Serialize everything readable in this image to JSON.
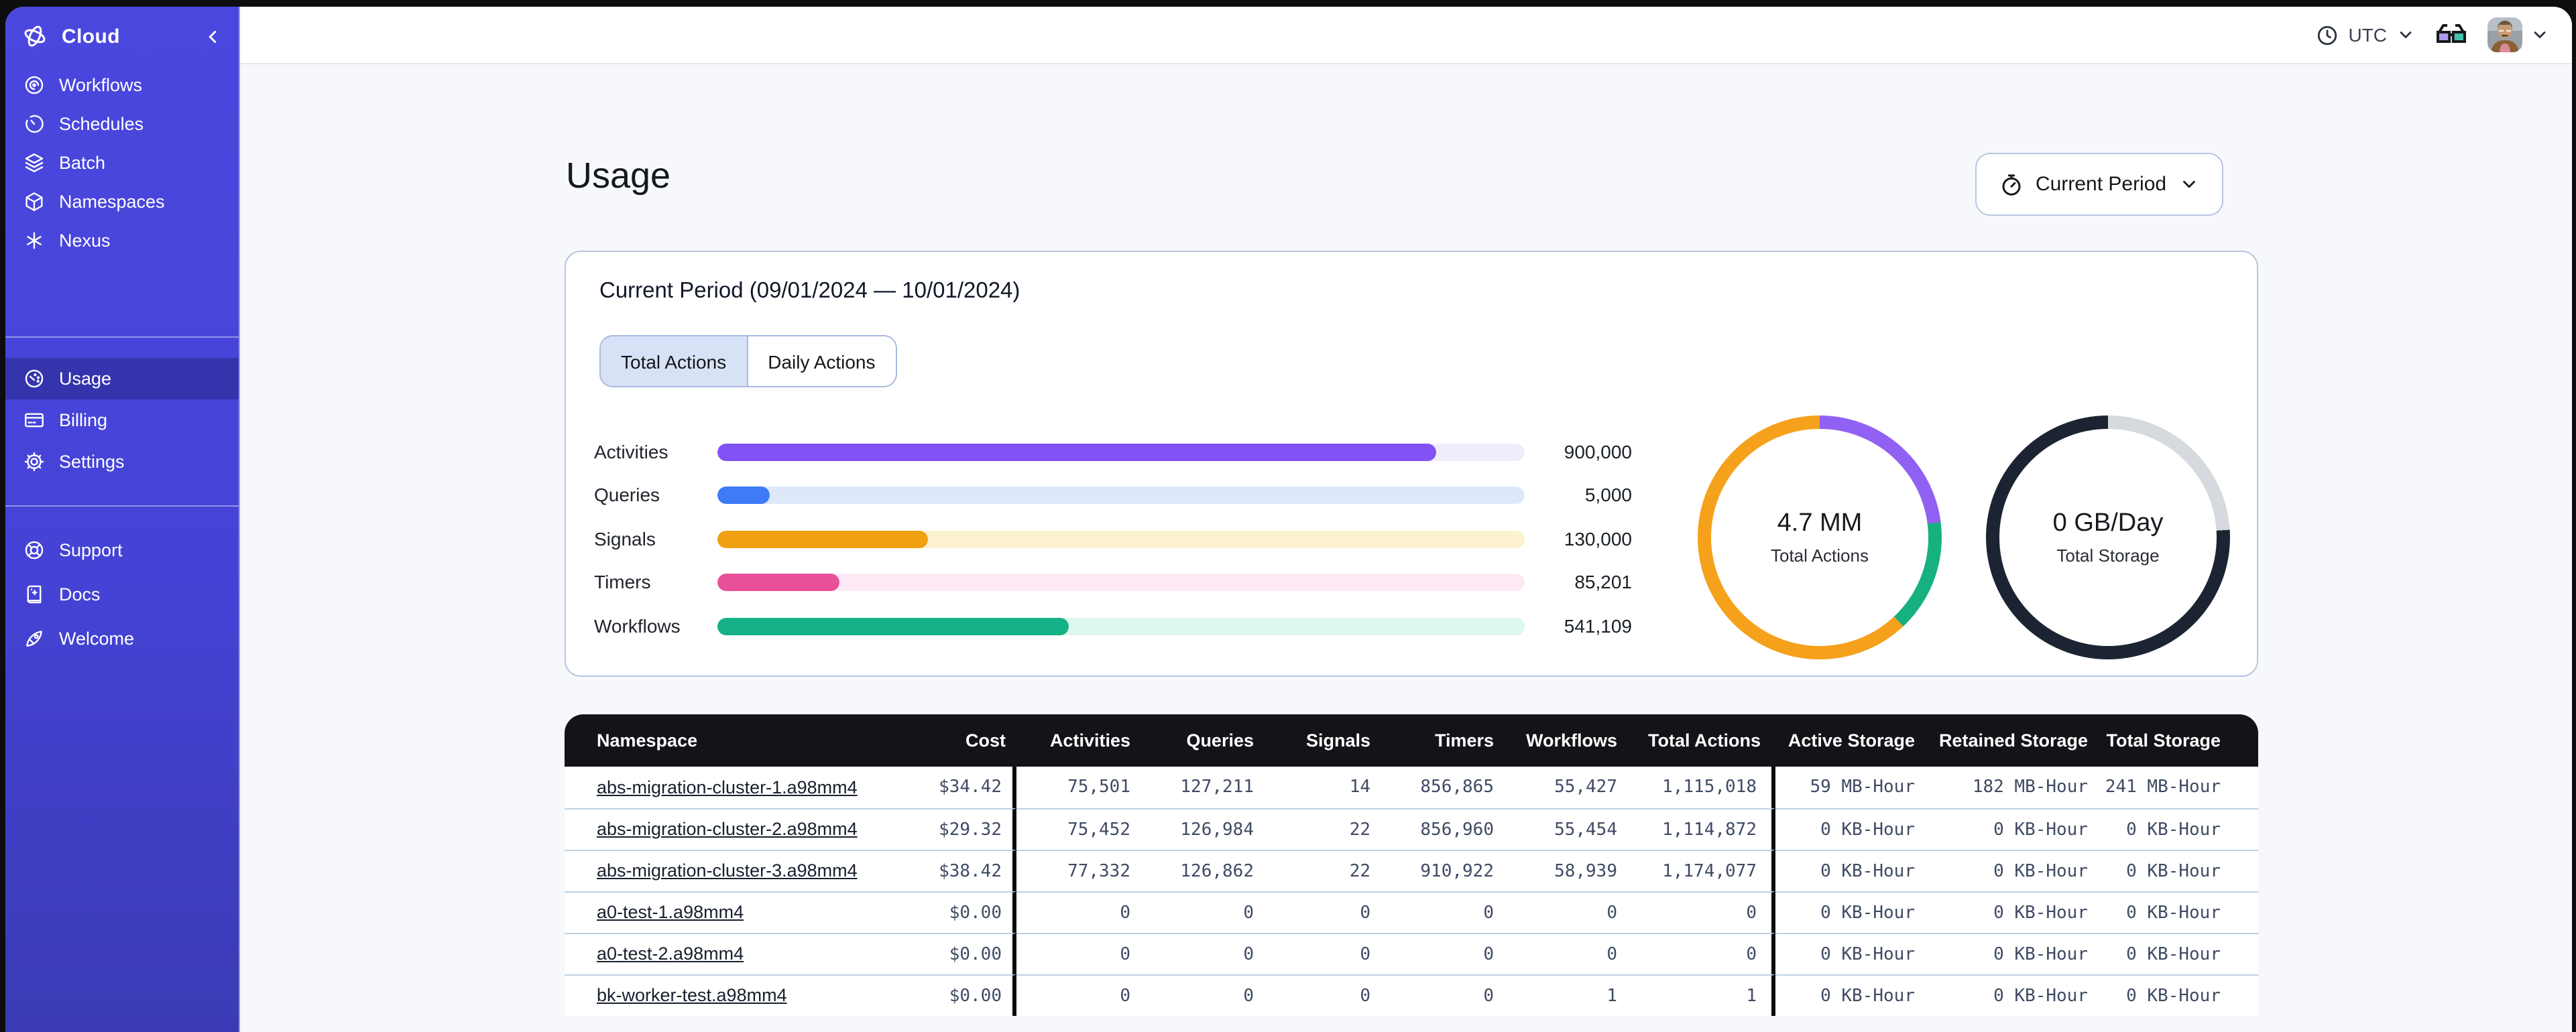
{
  "topbar": {
    "timezone": {
      "label": "UTC",
      "icon": "clock-icon"
    },
    "dev_mode_icon": "glasses-icon",
    "avatar_icon": "user-avatar"
  },
  "sidebar": {
    "brand": {
      "label": "Cloud",
      "icon": "temporal-logo-icon",
      "collapse_icon": "chevron-left-icon"
    },
    "sections": [
      {
        "items": [
          {
            "label": "Workflows",
            "icon": "workflows-icon",
            "active": false
          },
          {
            "label": "Schedules",
            "icon": "schedules-icon",
            "active": false
          },
          {
            "label": "Batch",
            "icon": "batch-icon",
            "active": false
          },
          {
            "label": "Namespaces",
            "icon": "namespaces-icon",
            "active": false
          },
          {
            "label": "Nexus",
            "icon": "nexus-icon",
            "active": false
          }
        ]
      },
      {
        "items": [
          {
            "label": "Usage",
            "icon": "usage-icon",
            "active": true
          },
          {
            "label": "Billing",
            "icon": "billing-icon",
            "active": false
          },
          {
            "label": "Settings",
            "icon": "settings-icon",
            "active": false
          }
        ]
      },
      {
        "items": [
          {
            "label": "Support",
            "icon": "support-icon",
            "active": false
          },
          {
            "label": "Docs",
            "icon": "docs-icon",
            "active": false
          },
          {
            "label": "Welcome",
            "icon": "welcome-icon",
            "active": false
          }
        ]
      }
    ]
  },
  "page": {
    "title": "Usage",
    "period_button": {
      "label": "Current Period",
      "icon": "stopwatch-icon",
      "chevron": "chevron-down-icon"
    }
  },
  "usage_card": {
    "title": "Current Period (09/01/2024 — 10/01/2024)",
    "tabs": [
      {
        "label": "Total Actions",
        "active": true
      },
      {
        "label": "Daily Actions",
        "active": false
      }
    ]
  },
  "chart_data": [
    {
      "type": "bar",
      "title": "Current Period usage by action type",
      "categories": [
        "Activities",
        "Queries",
        "Signals",
        "Timers",
        "Workflows"
      ],
      "values": [
        900000,
        5000,
        130000,
        85201,
        541109
      ],
      "display_values": [
        "900,000",
        "5,000",
        "130,000",
        "85,201",
        "541,109"
      ],
      "percent_filled": [
        89,
        6.5,
        26,
        15.1,
        43.6
      ],
      "colors": [
        {
          "fill": "#8252F5",
          "track": "#F0EDFB"
        },
        {
          "fill": "#3D7BF7",
          "track": "#DDE9FB"
        },
        {
          "fill": "#F0A010",
          "track": "#FCF2CF"
        },
        {
          "fill": "#E8509A",
          "track": "#FDE9F6"
        },
        {
          "fill": "#14B186",
          "track": "#DDF8EC"
        }
      ]
    },
    {
      "type": "donut",
      "center_value": "4.7 MM",
      "center_label": "Total Actions",
      "segments": [
        {
          "color": "#9161F3",
          "pct": 23
        },
        {
          "color": "#17B181",
          "pct": 15
        },
        {
          "color": "#F5A11B",
          "pct": 62
        }
      ]
    },
    {
      "type": "donut",
      "center_value": "0 GB/Day",
      "center_label": "Total Storage",
      "segments": [
        {
          "color": "#D6D9DD",
          "pct": 24
        },
        {
          "color": "#1C2433",
          "pct": 76
        }
      ]
    }
  ],
  "table": {
    "columns": [
      "Namespace",
      "Cost",
      "Activities",
      "Queries",
      "Signals",
      "Timers",
      "Workflows",
      "Total Actions",
      "Active Storage",
      "Retained Storage",
      "Total Storage"
    ],
    "rows": [
      {
        "namespace": "abs-migration-cluster-1.a98mm4",
        "cells": [
          "$34.42",
          "75,501",
          "127,211",
          "14",
          "856,865",
          "55,427",
          "1,115,018",
          "59 MB-Hour",
          "182 MB-Hour",
          "241 MB-Hour"
        ]
      },
      {
        "namespace": "abs-migration-cluster-2.a98mm4",
        "cells": [
          "$29.32",
          "75,452",
          "126,984",
          "22",
          "856,960",
          "55,454",
          "1,114,872",
          "0 KB-Hour",
          "0 KB-Hour",
          "0 KB-Hour"
        ]
      },
      {
        "namespace": "abs-migration-cluster-3.a98mm4",
        "cells": [
          "$38.42",
          "77,332",
          "126,862",
          "22",
          "910,922",
          "58,939",
          "1,174,077",
          "0 KB-Hour",
          "0 KB-Hour",
          "0 KB-Hour"
        ]
      },
      {
        "namespace": "a0-test-1.a98mm4",
        "cells": [
          "$0.00",
          "0",
          "0",
          "0",
          "0",
          "0",
          "0",
          "0 KB-Hour",
          "0 KB-Hour",
          "0 KB-Hour"
        ]
      },
      {
        "namespace": "a0-test-2.a98mm4",
        "cells": [
          "$0.00",
          "0",
          "0",
          "0",
          "0",
          "0",
          "0",
          "0 KB-Hour",
          "0 KB-Hour",
          "0 KB-Hour"
        ]
      },
      {
        "namespace": "bk-worker-test.a98mm4",
        "cells": [
          "$0.00",
          "0",
          "0",
          "0",
          "0",
          "1",
          "1",
          "0 KB-Hour",
          "0 KB-Hour",
          "0 KB-Hour"
        ]
      }
    ]
  }
}
